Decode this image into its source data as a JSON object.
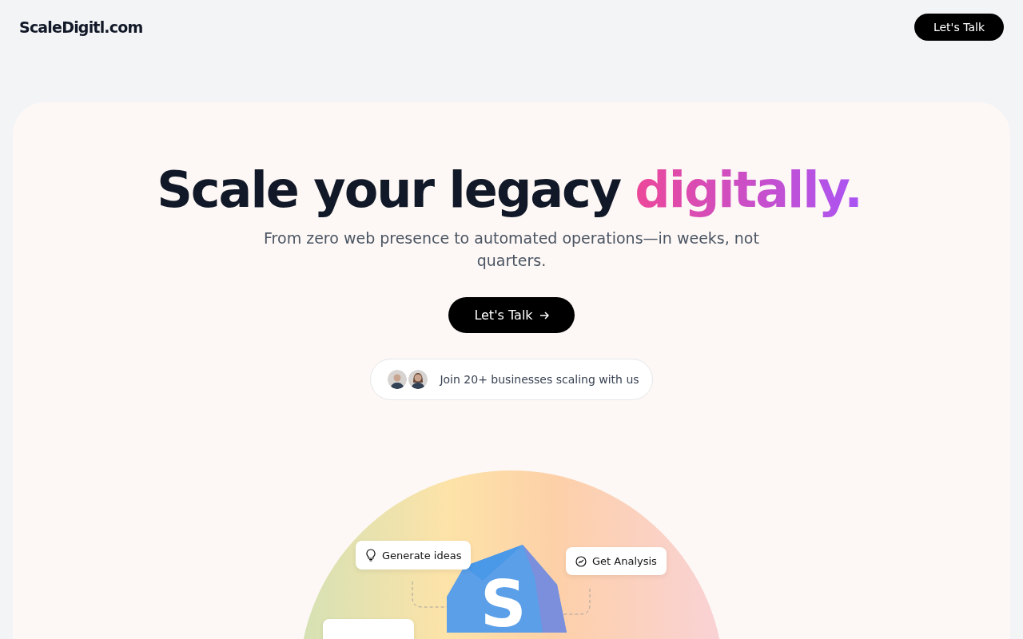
{
  "header": {
    "logo": "ScaleDigitl.com",
    "cta": "Let's Talk"
  },
  "hero": {
    "headline": "Scale your legacy",
    "headline_highlight": "digitally.",
    "subtitle": "From zero web presence to automated operations—in weeks, not quarters.",
    "cta": "Let's Talk",
    "social_proof": {
      "avatars": [
        {
          "kind": "man"
        },
        {
          "kind": "woman"
        }
      ],
      "text": "Join 20+ businesses scaling with us"
    }
  },
  "illustration": {
    "logo_letter": "S",
    "cards": [
      {
        "kind": "idea",
        "label": "Generate ideas"
      },
      {
        "kind": "analysis",
        "label": "Get Analysis"
      },
      {
        "kind": "blank"
      }
    ]
  }
}
